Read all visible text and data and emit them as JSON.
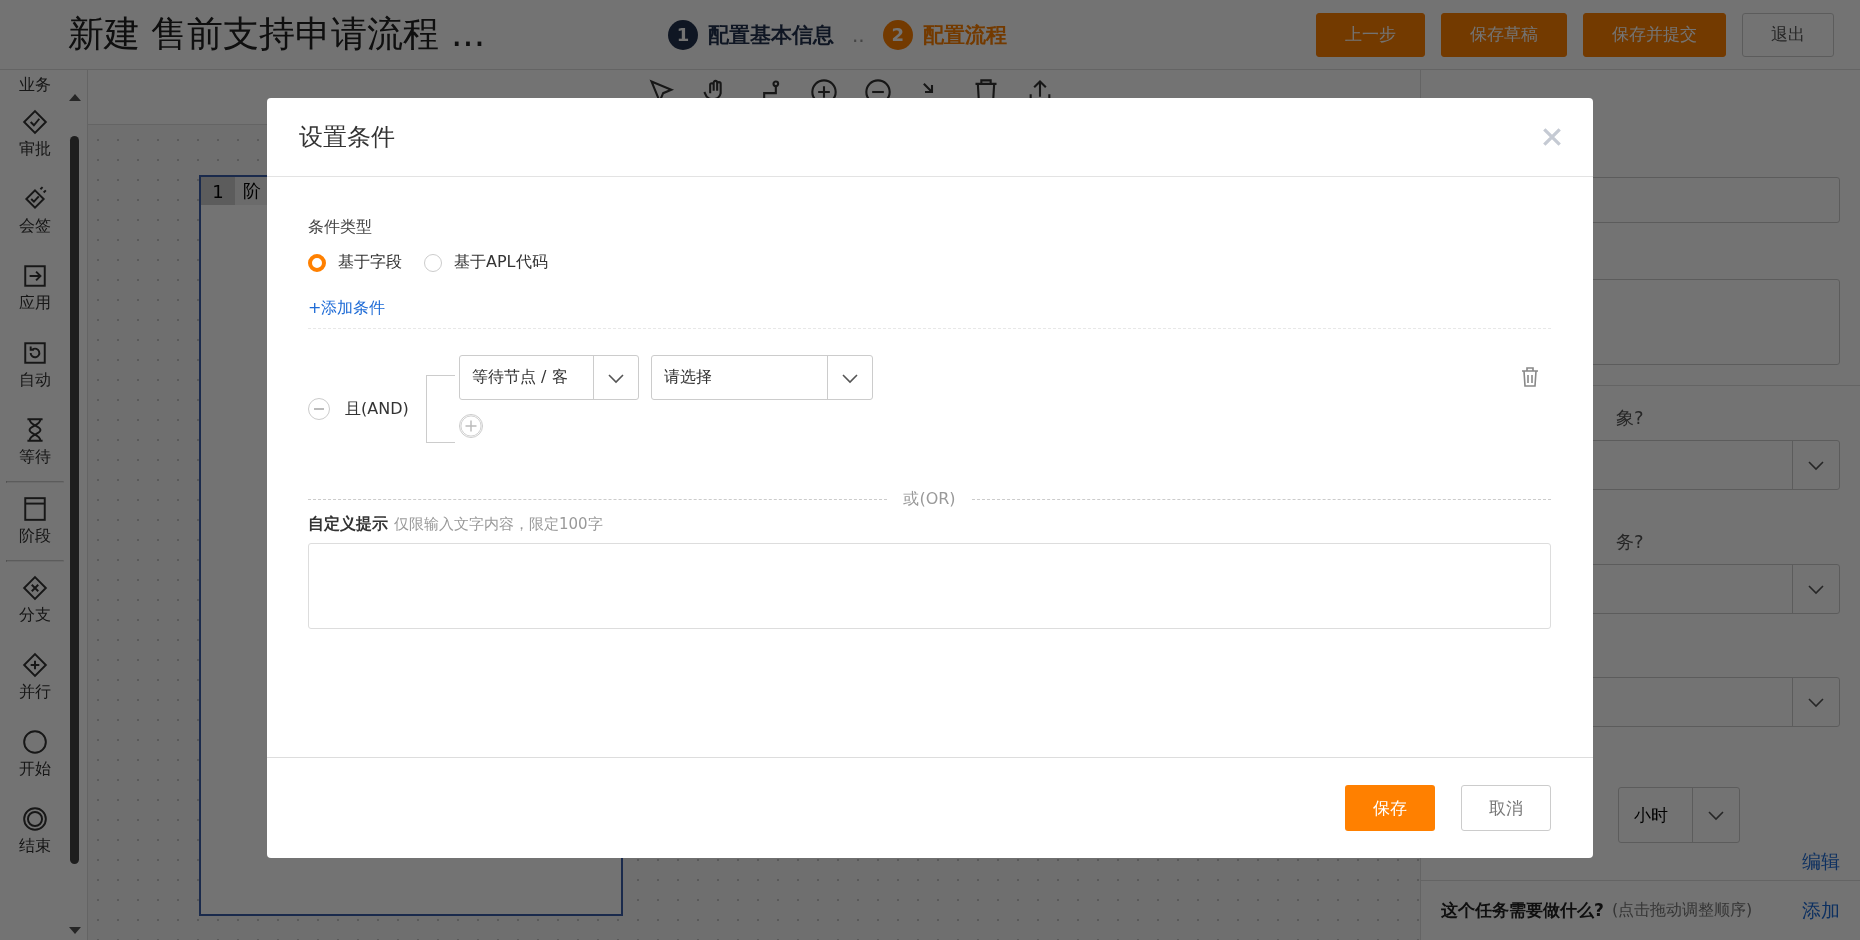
{
  "header": {
    "title": "新建 售前支持申请流程 ...",
    "steps": [
      {
        "number": "1",
        "label": "配置基本信息",
        "selected": false
      },
      {
        "number": "2",
        "label": "配置流程",
        "selected": true
      }
    ],
    "step_separator": "..",
    "buttons": [
      {
        "label": "上一步",
        "kind": "primary"
      },
      {
        "label": "保存草稿",
        "kind": "primary"
      },
      {
        "label": "保存并提交",
        "kind": "primary"
      },
      {
        "label": "退出",
        "kind": "default"
      }
    ]
  },
  "sidebar": {
    "items": [
      {
        "label": "业务"
      },
      {
        "label": "审批"
      },
      {
        "label": "会签"
      },
      {
        "label": "应用"
      },
      {
        "label": "自动"
      },
      {
        "label": "等待"
      },
      {
        "label": "阶段"
      },
      {
        "label": "分支"
      },
      {
        "label": "并行"
      },
      {
        "label": "开始"
      },
      {
        "label": "结束"
      }
    ]
  },
  "canvas": {
    "stage": {
      "number": "1",
      "label": "阶"
    }
  },
  "right_panel": {
    "question_1": "象?",
    "question_2": "务?",
    "unit_select": "小时",
    "edit_link": "编辑",
    "tasks_title": "这个任务需要做什么?",
    "tasks_hint": "(点击拖动调整顺序)",
    "add_link": "添加"
  },
  "dialog": {
    "title": "设置条件",
    "condition_type_label": "条件类型",
    "radios": [
      {
        "label": "基于字段",
        "selected": true
      },
      {
        "label": "基于APL代码",
        "selected": false
      }
    ],
    "add_condition": "+添加条件",
    "group": {
      "operator": "且(AND)",
      "selects": [
        {
          "value": "等待节点 / 客"
        },
        {
          "value": "请选择"
        }
      ]
    },
    "or_divider": "或(OR)",
    "hint_label": "自定义提示",
    "hint_note": "仅限输入文字内容，限定100字",
    "buttons": [
      {
        "label": "保存",
        "kind": "primary"
      },
      {
        "label": "取消",
        "kind": "default"
      }
    ]
  }
}
